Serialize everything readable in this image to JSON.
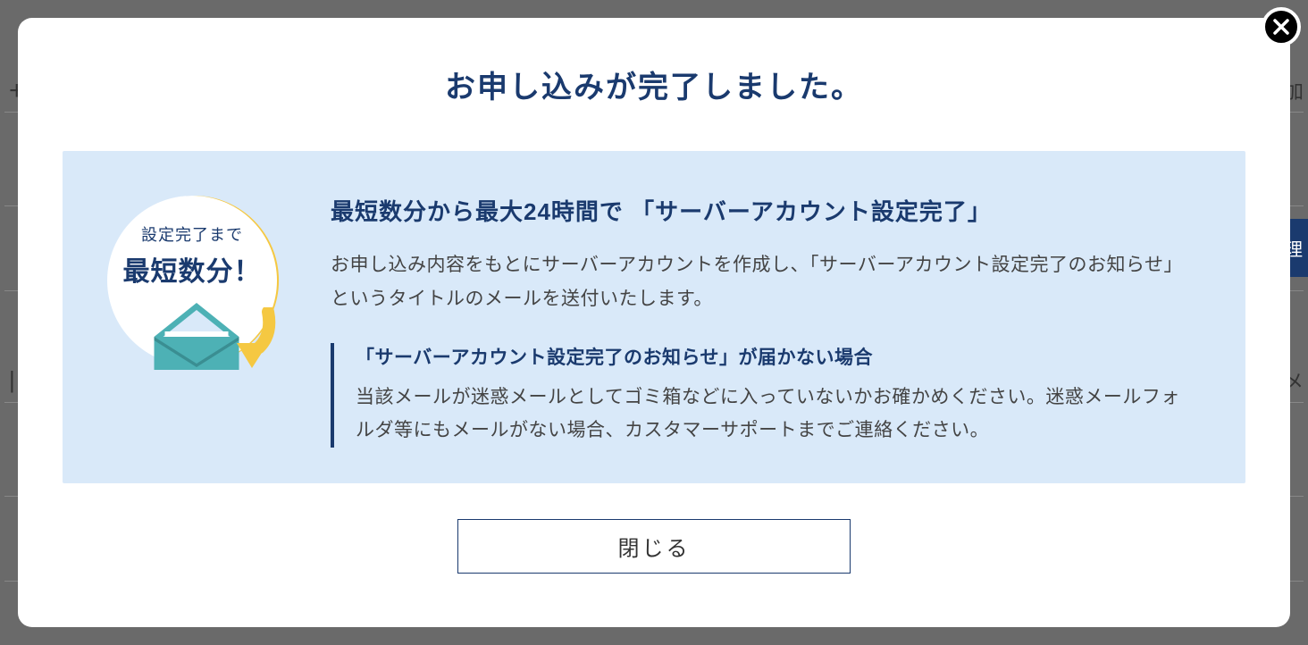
{
  "background": {
    "text_plus": "+",
    "text_add": "追加",
    "text_manage": "管理",
    "text_domain": "ドメ",
    "text_vbar": "|"
  },
  "modal": {
    "title": "お申し込みが完了しました。",
    "badge": {
      "small_text": "設定完了まで",
      "large_text": "最短数分！"
    },
    "info": {
      "heading": "最短数分から最大24時間で 「サーバーアカウント設定完了」",
      "description": "お申し込み内容をもとにサーバーアカウントを作成し、「サーバーアカウント設定完了のお知らせ」というタイトルのメールを送付いたします。"
    },
    "note": {
      "heading": "「サーバーアカウント設定完了のお知らせ」が届かない場合",
      "text": "当該メールが迷惑メールとしてゴミ箱などに入っていないかお確かめください。迷惑メールフォルダ等にもメールがない場合、カスタマーサポートまでご連絡ください。"
    },
    "close_button_label": "閉じる"
  }
}
